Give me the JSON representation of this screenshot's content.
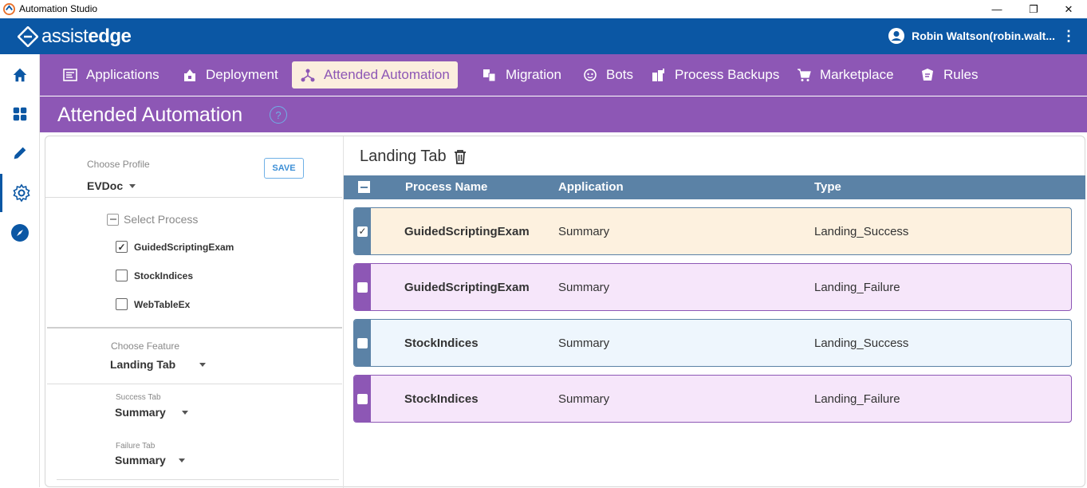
{
  "window": {
    "title": "Automation Studio",
    "minimize": "—",
    "maximize": "❐",
    "close": "✕"
  },
  "header": {
    "brand_light": "assist",
    "brand_bold": "edge",
    "user_name": "Robin Waltson(robin.walt...",
    "colors": {
      "header_bg": "#0b57a4",
      "nav_bg": "#8d57b5",
      "active_tab_bg": "#fbeede"
    }
  },
  "rail": {
    "items": [
      "home-icon",
      "dashboard-icon",
      "edit-icon",
      "settings-icon",
      "compass-icon"
    ],
    "active": "settings-icon"
  },
  "nav": {
    "tabs": [
      {
        "label": "Applications",
        "icon": "applications-icon"
      },
      {
        "label": "Deployment",
        "icon": "deployment-icon"
      },
      {
        "label": "Attended Automation",
        "icon": "attended-automation-icon",
        "active": true
      },
      {
        "label": "Migration",
        "icon": "migration-icon"
      },
      {
        "label": "Bots",
        "icon": "bots-icon"
      },
      {
        "label": "Process Backups",
        "icon": "process-backups-icon"
      },
      {
        "label": "Marketplace",
        "icon": "marketplace-icon"
      },
      {
        "label": "Rules",
        "icon": "rules-icon"
      }
    ]
  },
  "page": {
    "title": "Attended Automation",
    "help": "?"
  },
  "left": {
    "profile_label": "Choose Profile",
    "profile_value": "EVDoc",
    "save_label": "SAVE",
    "select_process_label": "Select Process",
    "processes": [
      {
        "name": "GuidedScriptingExam",
        "checked": true
      },
      {
        "name": "StockIndices",
        "checked": false
      },
      {
        "name": "WebTableEx",
        "checked": false
      }
    ],
    "feature_label": "Choose Feature",
    "feature_value": "Landing Tab",
    "success_label": "Success Tab",
    "success_value": "Summary",
    "failure_label": "Failure Tab",
    "failure_value": "Summary"
  },
  "right": {
    "title": "Landing Tab",
    "columns": [
      "Process Name",
      "Application",
      "Type"
    ],
    "rows": [
      {
        "name": "GuidedScriptingExam",
        "application": "Summary",
        "type": "Landing_Success",
        "checked": true,
        "bg": "#fdf1df",
        "accent": "#5b82a6"
      },
      {
        "name": "GuidedScriptingExam",
        "application": "Summary",
        "type": "Landing_Failure",
        "checked": false,
        "bg": "#f6e6fa",
        "accent": "#8d57b5"
      },
      {
        "name": "StockIndices",
        "application": "Summary",
        "type": "Landing_Success",
        "checked": false,
        "bg": "#eef6fd",
        "accent": "#5b82a6"
      },
      {
        "name": "StockIndices",
        "application": "Summary",
        "type": "Landing_Failure",
        "checked": false,
        "bg": "#f6e6fa",
        "accent": "#8d57b5"
      }
    ]
  }
}
